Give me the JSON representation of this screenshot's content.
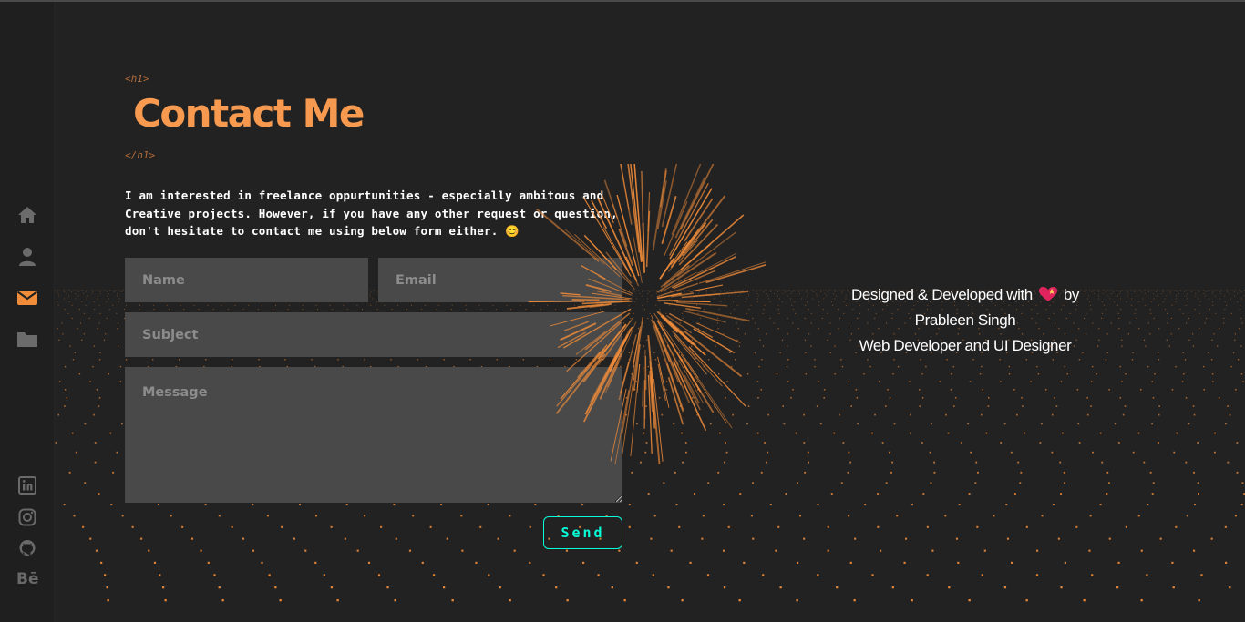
{
  "sidebar": {
    "nav": [
      {
        "icon": "home-icon",
        "active": false
      },
      {
        "icon": "user-icon",
        "active": false
      },
      {
        "icon": "envelope-icon",
        "active": true
      },
      {
        "icon": "folder-icon",
        "active": false
      }
    ],
    "social": [
      {
        "icon": "linkedin-icon"
      },
      {
        "icon": "instagram-icon"
      },
      {
        "icon": "github-icon"
      },
      {
        "icon": "behance-icon",
        "label": "Bē"
      }
    ]
  },
  "contact": {
    "tag_open": "<h1>",
    "title": "Contact Me",
    "tag_close": "</h1>",
    "intro": [
      "I am interested in freelance oppurtunities - especially ambitous and",
      "Creative projects. However, if you have any other request or question,",
      "don't hesitate to contact me using below form either. 😊"
    ],
    "form": {
      "name_placeholder": "Name",
      "email_placeholder": "Email",
      "subject_placeholder": "Subject",
      "message_placeholder": "Message",
      "send_label": "Send"
    }
  },
  "footer": {
    "credit_prefix": "Designed & Developed with",
    "credit_suffix": "by",
    "name": "Prableen Singh",
    "role": "Web Developer and UI Designer"
  },
  "colors": {
    "accent": "#f79a4f",
    "send": "#08fdd8",
    "background": "#222222",
    "active_nav": "#f08c3a"
  }
}
